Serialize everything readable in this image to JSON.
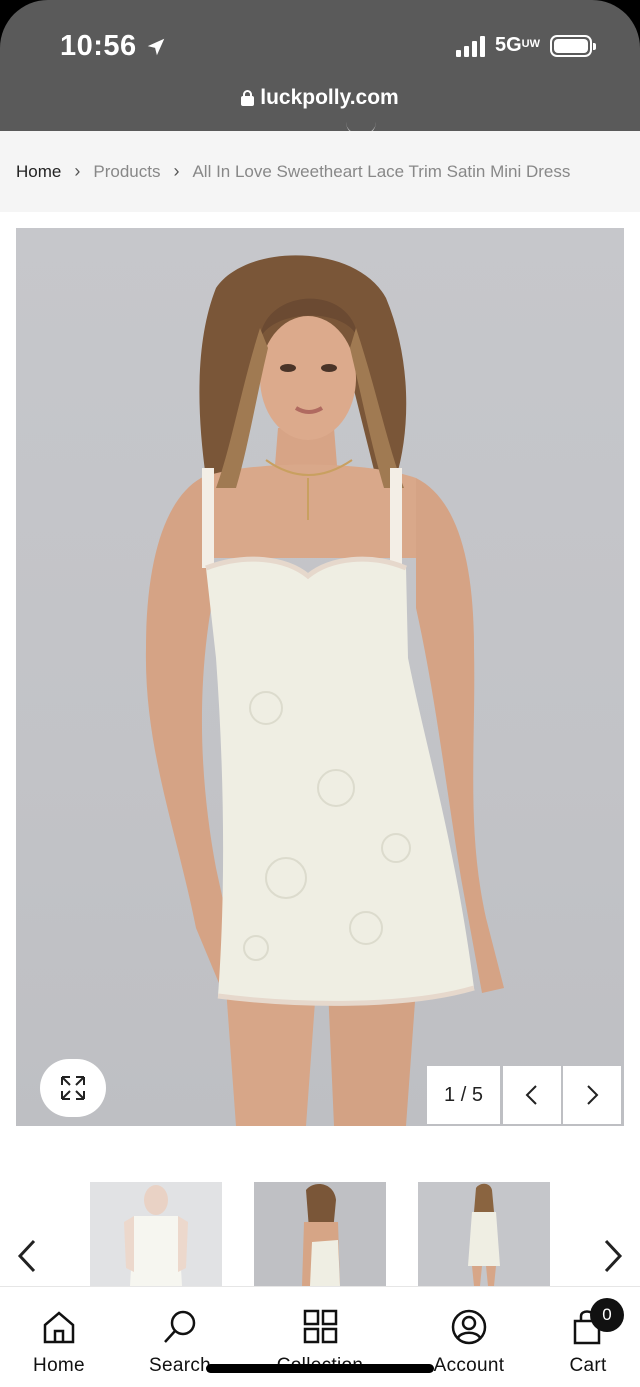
{
  "status_bar": {
    "time": "10:56",
    "network": "5G",
    "network_suffix": "UW"
  },
  "browser": {
    "url": "luckpolly.com"
  },
  "breadcrumb": {
    "items": [
      "Home",
      "Products",
      "All In Love Sweetheart Lace Trim Satin Mini Dress"
    ]
  },
  "gallery": {
    "counter": "1 / 5",
    "main_image_alt": "model-in-ivory-satin-mini-dress"
  },
  "icons": {
    "zoom": "expand-icon",
    "prev": "chevron-left-icon",
    "next": "chevron-right-icon"
  },
  "bottom_nav": {
    "items": [
      {
        "label": "Home",
        "icon": "home-icon"
      },
      {
        "label": "Search",
        "icon": "search-icon"
      },
      {
        "label": "Collection",
        "icon": "grid-icon"
      },
      {
        "label": "Account",
        "icon": "user-icon"
      },
      {
        "label": "Cart",
        "icon": "bag-icon"
      }
    ],
    "cart_count": "0"
  },
  "colors": {
    "chrome": "#5a5a5a",
    "breadcrumb_bg": "#f5f5f5",
    "photo_bg": "#c4c5c9",
    "dress": "#eeeee2",
    "skin": "#d9a88a",
    "hair": "#6b4a32"
  }
}
